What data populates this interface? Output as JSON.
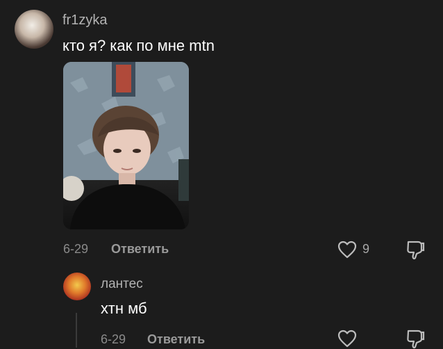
{
  "comments": [
    {
      "username": "fr1zyka",
      "text": "кто я? как по мне mtn",
      "date": "6-29",
      "reply_label": "Ответить",
      "likes": "9"
    }
  ],
  "replies": [
    {
      "username": "лантес",
      "text": "хтн мб",
      "date": "6-29",
      "reply_label": "Ответить"
    }
  ],
  "colors": {
    "background": "#1c1c1c",
    "username": "#b3b3b3",
    "meta": "#8a8a8a",
    "thread_line": "#3a3a3a"
  },
  "icons": {
    "like": "heart-icon",
    "dislike": "thumbs-down-icon"
  }
}
